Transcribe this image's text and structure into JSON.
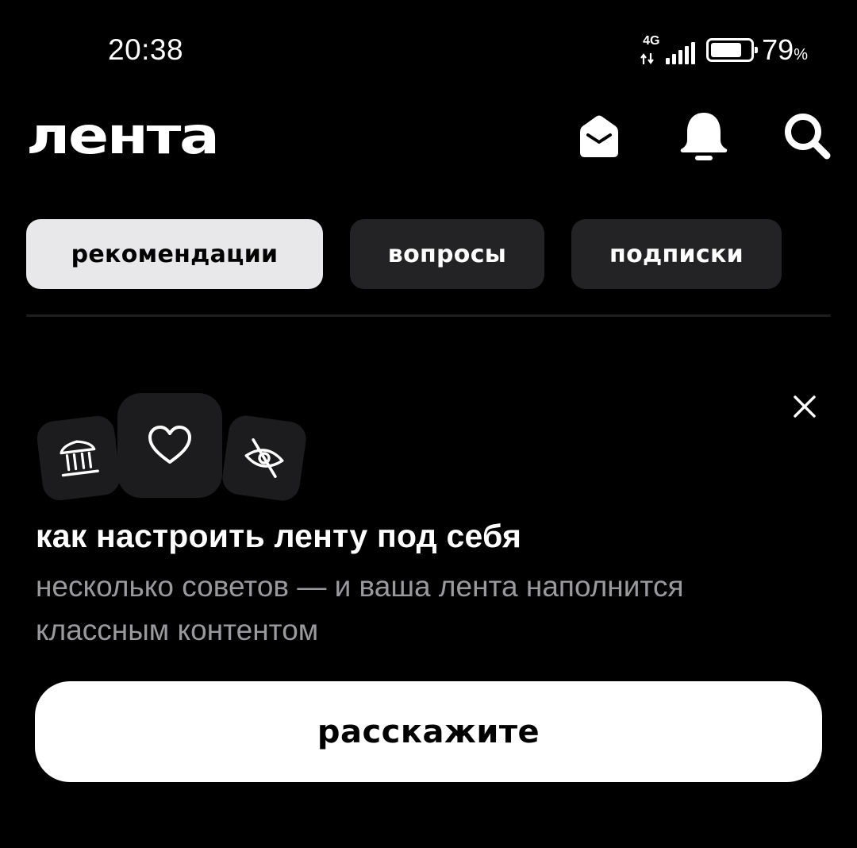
{
  "status_bar": {
    "time": "20:38",
    "network": "4G",
    "battery_percent": 79,
    "battery_text": "79",
    "battery_unit": "%"
  },
  "header": {
    "logo": "лента",
    "icons": [
      "mail-icon",
      "bell-icon",
      "search-icon"
    ]
  },
  "tabs": [
    {
      "label": "рекомендации",
      "active": true
    },
    {
      "label": "вопросы",
      "active": false
    },
    {
      "label": "подписки",
      "active": false
    }
  ],
  "onboarding": {
    "icons": [
      "museum-icon",
      "heart-icon",
      "eye-off-icon"
    ],
    "title": "как настроить ленту под себя",
    "subtitle": "несколько советов — и ваша лента наполнится классным контентом",
    "button_label": "расскажите"
  },
  "colors": {
    "background": "#000000",
    "tab_active_bg": "#e8e8ea",
    "tab_bg": "#232325",
    "tile_bg": "#1c1c1e",
    "subtitle": "#9a9a9e",
    "button_bg": "#ffffff"
  }
}
